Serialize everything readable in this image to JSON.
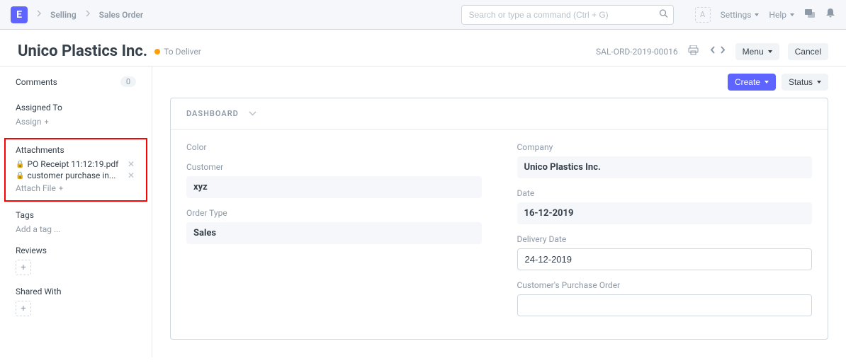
{
  "navbar": {
    "logo_letter": "E",
    "breadcrumb": [
      "Selling",
      "Sales Order"
    ],
    "search_placeholder": "Search or type a command (Ctrl + G)",
    "avatar_letter": "A",
    "settings_label": "Settings",
    "help_label": "Help"
  },
  "page": {
    "title": "Unico Plastics Inc.",
    "status": "To Deliver",
    "doc_id": "SAL-ORD-2019-00016",
    "menu_label": "Menu",
    "cancel_label": "Cancel"
  },
  "sidebar": {
    "comments": {
      "label": "Comments",
      "count": "0"
    },
    "assigned": {
      "label": "Assigned To",
      "action": "Assign"
    },
    "attachments": {
      "label": "Attachments",
      "files": [
        {
          "name": "PO Receipt 11:12:19.pdf"
        },
        {
          "name": "customer purchase in..."
        }
      ],
      "action": "Attach File"
    },
    "tags": {
      "label": "Tags",
      "action": "Add a tag ..."
    },
    "reviews": {
      "label": "Reviews"
    },
    "shared": {
      "label": "Shared With"
    }
  },
  "toolbar": {
    "create_label": "Create",
    "status_label": "Status"
  },
  "form": {
    "dashboard_label": "DASHBOARD",
    "left": {
      "color_label": "Color",
      "customer_label": "Customer",
      "customer_value": "xyz",
      "order_type_label": "Order Type",
      "order_type_value": "Sales"
    },
    "right": {
      "company_label": "Company",
      "company_value": "Unico Plastics Inc.",
      "date_label": "Date",
      "date_value": "16-12-2019",
      "delivery_label": "Delivery Date",
      "delivery_value": "24-12-2019",
      "po_label": "Customer's Purchase Order",
      "po_value": ""
    }
  }
}
